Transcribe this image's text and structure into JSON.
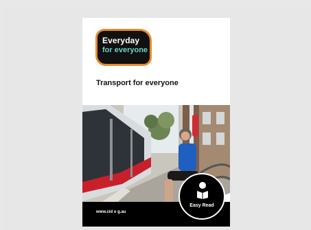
{
  "brand": {
    "logo_line1": "Everyday",
    "logo_line2": "for everyone",
    "border_color": "#e88a2c",
    "accent_text_color": "#6fd1c6"
  },
  "cover": {
    "title": "Transport for everyone",
    "website": "www.cid o g.au",
    "badge_label": "Easy Read",
    "badge_icon": "person-reading-icon"
  }
}
